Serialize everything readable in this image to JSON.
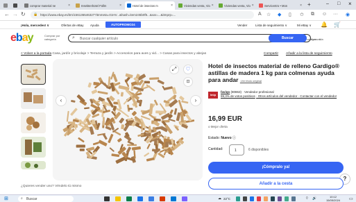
{
  "browser": {
    "tabs": [
      {
        "label": "",
        "color": "#8a8a8a"
      },
      {
        "label": "comprar material ne",
        "color": "#777"
      },
      {
        "label": "Insektenhotel Füllm",
        "color": "#c8a24a"
      },
      {
        "label": "Hotel de insectos m",
        "color": "#0064d2"
      },
      {
        "label": "Viviendas venta, Vio",
        "color": "#66aa33"
      },
      {
        "label": "Viviendas venta, Vio",
        "color": "#66aa33"
      },
      {
        "label": "Servicentro • Mon",
        "color": "#e55"
      }
    ],
    "new_tab": "+",
    "url": "https://www.ebay.es/itm/156136546327?itmmeta=01HV...&hash=item245b0f5...&var=...&itmprp=...",
    "window_controls": [
      "–",
      "□",
      "×"
    ]
  },
  "ebay_top": {
    "greeting": "¡Hola, mercedes! ∨",
    "ofertas": "Ofertas de eBay",
    "ayuda": "Ayuda",
    "promo": "AUTOPROMO24",
    "vender": "Vender",
    "seguimiento": "Lista de seguimiento ∨",
    "mi_ebay": "Mi eBay ∨"
  },
  "search": {
    "logo": [
      "e",
      "b",
      "a",
      "y"
    ],
    "logo_colors": [
      "#e53238",
      "#0064d2",
      "#f5af02",
      "#86b817"
    ],
    "category_label": "Comprar por categoría",
    "placeholder": "Buscar cualquier artículo",
    "category_dropdown": "Todas las categor... ∨",
    "button": "Buscar",
    "advanced": "Avanzada"
  },
  "breadcrumbs": {
    "back": "< Volver a la portada",
    "path": "Casa, jardín y bricolaje > Terraza y jardín > Accesorios para aves y vid... > Casas para insectos y abejas",
    "share": "Compartir",
    "watchlist": "Añadir a la lista de seguimiento"
  },
  "product": {
    "title": "Hotel de insectos material de relleno Gardigo® astillas de madera 1 kg para colmenas ayuda para andar",
    "title_note": "-Ver título original",
    "seller_name": "faviqo",
    "seller_score": "(80863)",
    "seller_type": "· Vendedor profesional",
    "seller_feedback": "99,3% de votos positivos",
    "seller_links": "· Otros artículos del vendedor · Contactar con el vendedor",
    "price": "16,99 EUR",
    "offer": "o Mejor oferta",
    "estado_label": "Estado:",
    "estado_value": "Nuevo",
    "cantidad_label": "Cantidad:",
    "cantidad_value": "1",
    "disponibles": "6 disponibles",
    "buy_now": "¡Cómpralo ya!",
    "add_to_cart": "Añadir a la cesta"
  },
  "sell_prompt": "¿Quieres vender uno? Véndelo tú mismo",
  "taskbar": {
    "search": "Buscar",
    "weather": "22°C",
    "time": "10:12",
    "date": "15/05/2024"
  }
}
